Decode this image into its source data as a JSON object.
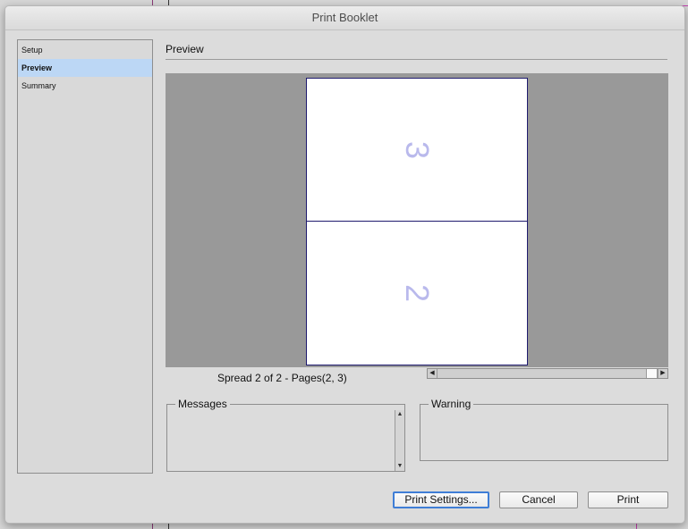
{
  "dialog": {
    "title": "Print Booklet"
  },
  "sidebar": {
    "items": [
      {
        "label": "Setup",
        "active": false
      },
      {
        "label": "Preview",
        "active": true
      },
      {
        "label": "Summary",
        "active": false
      }
    ]
  },
  "preview": {
    "section_title": "Preview",
    "pages": {
      "top": "3",
      "bottom": "2"
    },
    "spread_label": "Spread 2 of 2 - Pages(2, 3)",
    "page_border_color": "#1e1a6e",
    "page_number_color": "#b9b9ec",
    "background_color": "#999999"
  },
  "panels": {
    "messages_label": "Messages",
    "warning_label": "Warning"
  },
  "buttons": {
    "print_settings": "Print Settings...",
    "cancel": "Cancel",
    "print": "Print"
  },
  "icons": {
    "scroll_left": "triangle-left-icon",
    "scroll_right": "triangle-right-icon",
    "scroll_up": "triangle-up-icon",
    "scroll_down": "triangle-down-icon"
  }
}
